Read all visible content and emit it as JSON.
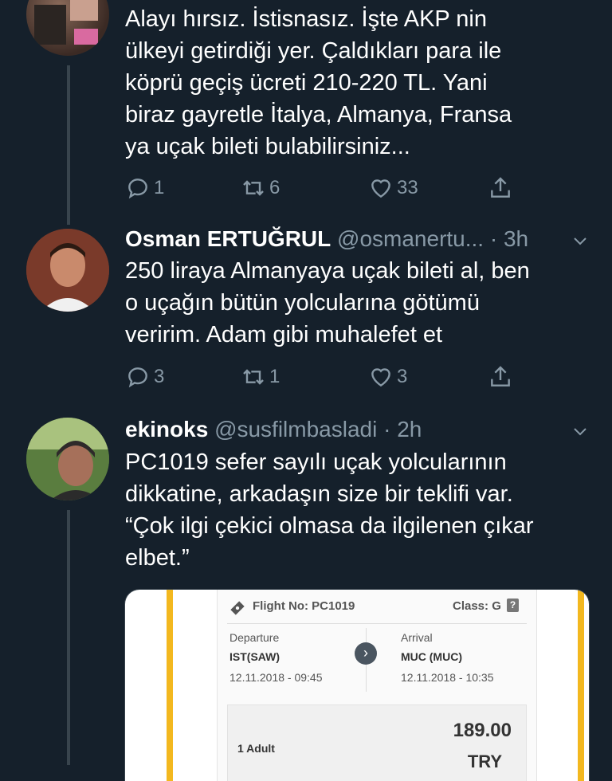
{
  "tweets": [
    {
      "text": "Alayı hırsız. İstisnasız. İşte AKP nin\nülkeyi getirdiği yer. Çaldıkları para ile\nköprü geçiş ücreti 210-220 TL. Yani\nbiraz gayretle  İtalya, Almanya, Fransa\nya uçak bileti bulabilirsiniz...",
      "replies": "1",
      "retweets": "6",
      "likes": "33"
    },
    {
      "name": "Osman ERTUĞRUL",
      "handle": "@osmanertu...",
      "time": "· 3h",
      "text": "250 liraya Almanyaya uçak bileti al, ben\no uçağın bütün yolcularına götümü\nveririm. Adam gibi muhalefet et",
      "replies": "3",
      "retweets": "1",
      "likes": "3"
    },
    {
      "name": "ekinoks",
      "handle": "@susfilmbasladi",
      "time": "· 2h",
      "text": "PC1019 sefer sayılı uçak yolcularının\ndikkatine, arkadaşın size bir teklifi var.\n“Çok ilgi çekici olmasa da ilgilenen çıkar\nelbet.”"
    }
  ],
  "ticket": {
    "flight_label": "Flight No: PC1019",
    "class_label": "Class: G",
    "departure_label": "Departure",
    "departure_code": "IST(SAW)",
    "departure_time": "12.11.2018 - 09:45",
    "arrival_label": "Arrival",
    "arrival_code": "MUC (MUC)",
    "arrival_time": "12.11.2018 - 10:35",
    "passengers": "1 Adult",
    "price": "189.00",
    "currency": "TRY"
  },
  "colors": {
    "background": "#15202b",
    "muted": "#8899a6",
    "accent": "#f3b81f"
  },
  "icons": [
    "reply-icon",
    "retweet-icon",
    "like-icon",
    "share-icon",
    "chevron-down-icon",
    "ticket-icon",
    "arrow-right-icon"
  ]
}
